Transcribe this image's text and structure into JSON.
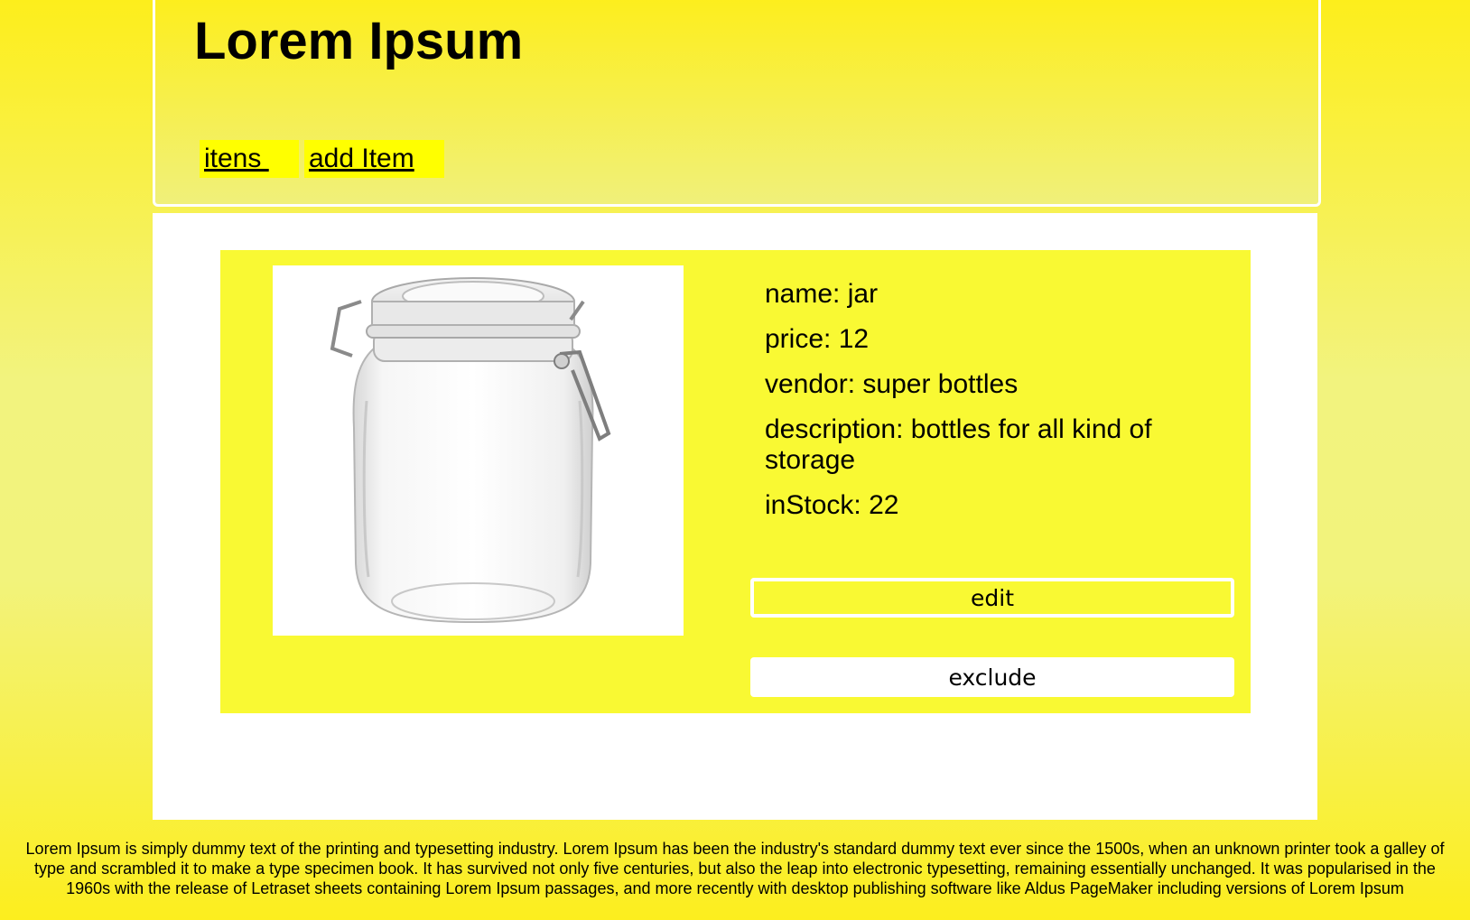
{
  "header": {
    "title": "Lorem Ipsum",
    "nav": [
      {
        "label": "itens "
      },
      {
        "label": "add Item"
      }
    ]
  },
  "product": {
    "image_alt": "glass jar with clamp lid",
    "fields": [
      {
        "label": "name:",
        "value": "jar"
      },
      {
        "label": "price:",
        "value": "12"
      },
      {
        "label": "vendor:",
        "value": "super bottles"
      },
      {
        "label": "description:",
        "value": "bottles for all kind of storage"
      },
      {
        "label": "inStock:",
        "value": "22"
      }
    ],
    "edit_label": "edit",
    "exclude_label": "exclude"
  },
  "footer": {
    "text": "Lorem Ipsum is simply dummy text of the printing and typesetting industry. Lorem Ipsum has been the industry's standard dummy text ever since the 1500s, when an unknown printer took a galley of type and scrambled it to make a type specimen book. It has survived not only five centuries, but also the leap into electronic typesetting, remaining essentially unchanged. It was popularised in the 1960s with the release of Letraset sheets containing Lorem Ipsum passages, and more recently with desktop publishing software like Aldus PageMaker including versions of Lorem Ipsum"
  },
  "colors": {
    "background": "#fdee1c",
    "card": "#f9f933",
    "nav_link_bg": "#ffff00",
    "panel": "#ffffff"
  }
}
